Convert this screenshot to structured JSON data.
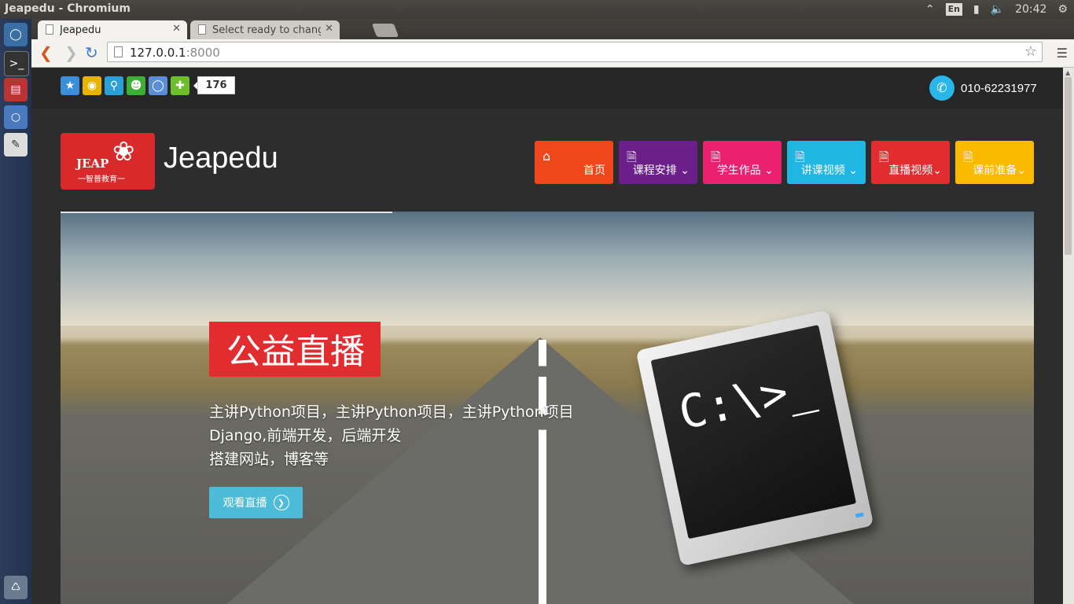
{
  "os": {
    "window_title": "Jeapedu - Chromium",
    "clock": "20:42",
    "lang": "En"
  },
  "browser": {
    "tabs": [
      {
        "label": "Jeapedu",
        "active": true
      },
      {
        "label": "Select ready to chang",
        "active": false
      }
    ],
    "url_host": "127.0.0.1",
    "url_port": ":8000"
  },
  "page": {
    "share_count": "176",
    "phone": "010-62231977",
    "logo_text": "JEAP",
    "logo_subtext": "一智普教育一",
    "site_name": "Jeapedu",
    "nav": [
      {
        "label": "首页",
        "icon": "home-icon",
        "color": "#f0461c"
      },
      {
        "label": "课程安排",
        "icon": "file-icon",
        "color": "#6b1f8a"
      },
      {
        "label": "学生作品",
        "icon": "file-icon",
        "color": "#ea2070"
      },
      {
        "label": "讲课视频",
        "icon": "file-icon",
        "color": "#1fb6e4"
      },
      {
        "label": "直播视频",
        "icon": "file-icon",
        "color": "#e12d30"
      },
      {
        "label": "课前准备",
        "icon": "file-icon",
        "color": "#fbb900"
      }
    ],
    "banner": {
      "title": "公益直播",
      "lines": [
        "主讲Python项目，主讲Python项目，主讲Python项目",
        "Django,前端开发，后端开发",
        "搭建网站，博客等"
      ],
      "button": "观看直播",
      "monitor_prompt": "C:\\>_"
    }
  }
}
